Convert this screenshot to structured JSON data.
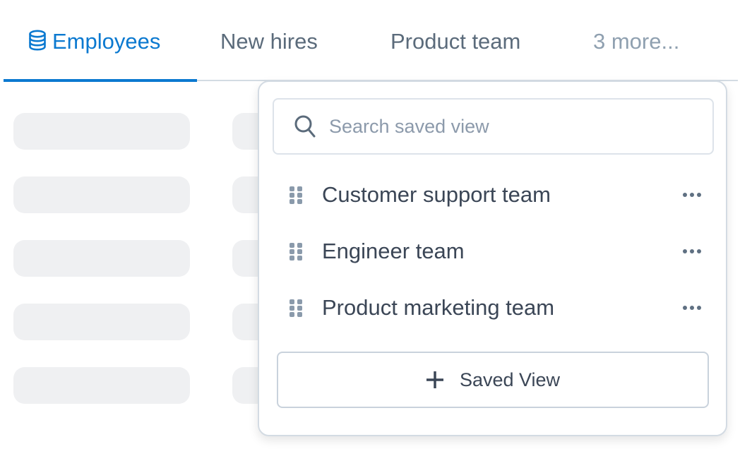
{
  "tabs": [
    {
      "label": "Employees",
      "icon": "database-icon",
      "active": true
    },
    {
      "label": "New hires",
      "active": false
    },
    {
      "label": "Product team",
      "active": false
    },
    {
      "label": "3 more...",
      "active": false
    }
  ],
  "colors": {
    "accent": "#0b79d0",
    "tab_text": "#5b6b7b",
    "tab_more_text": "#8fa0b0",
    "skeleton": "#eff0f2",
    "item_text": "#3b4656",
    "icon_muted": "#8a9aab"
  },
  "saved_views_popover": {
    "search": {
      "placeholder": "Search saved view",
      "value": "",
      "icon": "search-icon"
    },
    "items": [
      {
        "label": "Customer support team",
        "handle_icon": "drag-handle-icon",
        "menu_icon": "more-horizontal-icon"
      },
      {
        "label": "Engineer team",
        "handle_icon": "drag-handle-icon",
        "menu_icon": "more-horizontal-icon"
      },
      {
        "label": "Product marketing team",
        "handle_icon": "drag-handle-icon",
        "menu_icon": "more-horizontal-icon"
      }
    ],
    "add_button": {
      "label": "Saved View",
      "icon": "plus-icon"
    }
  }
}
